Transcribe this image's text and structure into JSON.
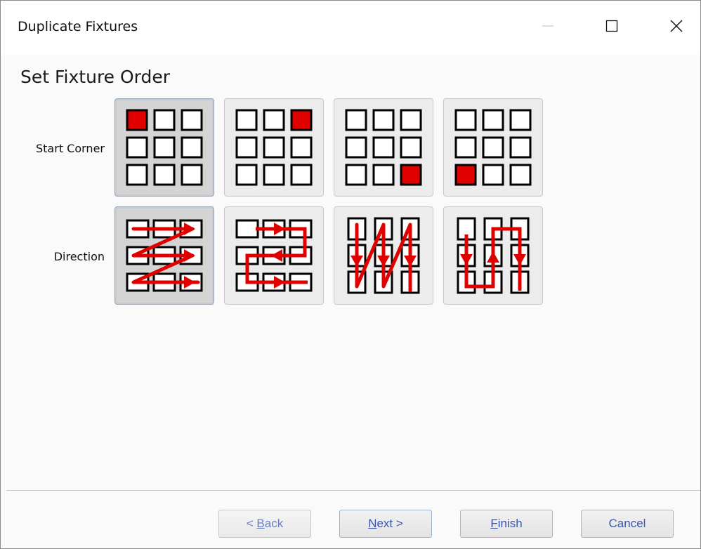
{
  "window": {
    "title": "Duplicate Fixtures",
    "controls": [
      "minimize",
      "maximize",
      "close"
    ]
  },
  "page": {
    "heading": "Set Fixture Order"
  },
  "rows": {
    "start_corner_label": "Start Corner",
    "direction_label": "Direction"
  },
  "start_corner_options": [
    {
      "corner": "top-left",
      "selected": true
    },
    {
      "corner": "top-right",
      "selected": false
    },
    {
      "corner": "bottom-right",
      "selected": false
    },
    {
      "corner": "bottom-left",
      "selected": false
    }
  ],
  "direction_options": [
    {
      "pattern": "horizontal-zigzag",
      "selected": true
    },
    {
      "pattern": "horizontal-snake",
      "selected": false
    },
    {
      "pattern": "vertical-zigzag",
      "selected": false
    },
    {
      "pattern": "vertical-snake",
      "selected": false
    }
  ],
  "buttons": {
    "back": {
      "prefix": "< ",
      "accel": "B",
      "rest": "ack"
    },
    "next": {
      "accel": "N",
      "rest": "ext >"
    },
    "finish": {
      "accel": "F",
      "rest": "inish"
    },
    "cancel": {
      "label": "Cancel"
    }
  },
  "colors": {
    "accent_red": "#e00000",
    "cell_border": "#000000",
    "tile_bg": "#ececec",
    "tile_selected_bg": "#d4d4d4"
  }
}
